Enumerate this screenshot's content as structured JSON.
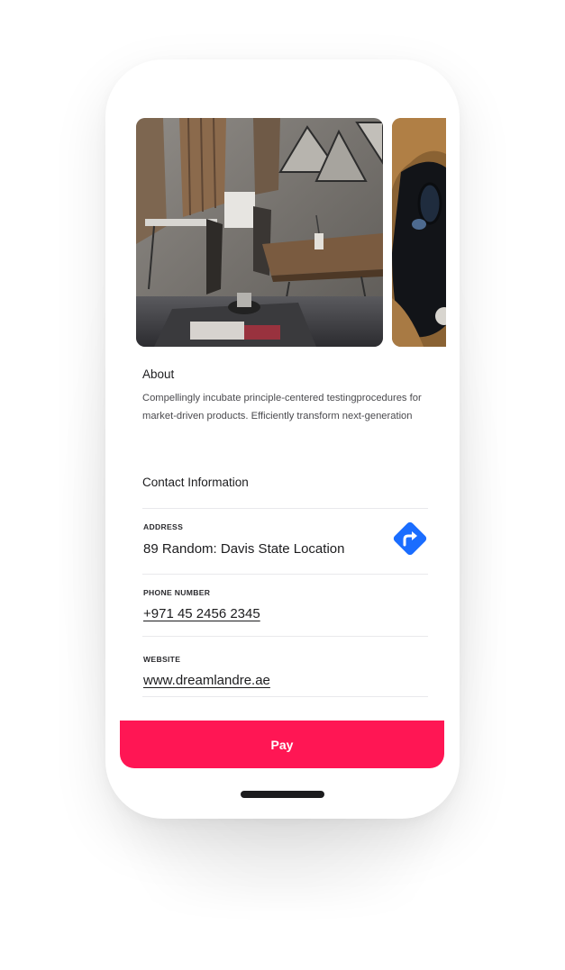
{
  "gallery": {
    "photos": [
      "restaurant-interior-photo",
      "table-detail-photo"
    ]
  },
  "about": {
    "title": "About",
    "text": "Compellingly incubate principle-centered testingprocedures for market-driven products. Efficiently transform next-generation"
  },
  "contact": {
    "title": "Contact Information",
    "address": {
      "label": "ADDRESS",
      "value": "89 Random: Davis State Location",
      "icon": "directions-icon"
    },
    "phone": {
      "label": "PHONE NUMBER",
      "value": "+971 45 2456 2345"
    },
    "website": {
      "label": "WEBSITE",
      "value": "www.dreamlandre.ae"
    }
  },
  "actions": {
    "pay_label": "Pay"
  },
  "colors": {
    "accent": "#ff1654",
    "directions": "#1a6dff"
  }
}
